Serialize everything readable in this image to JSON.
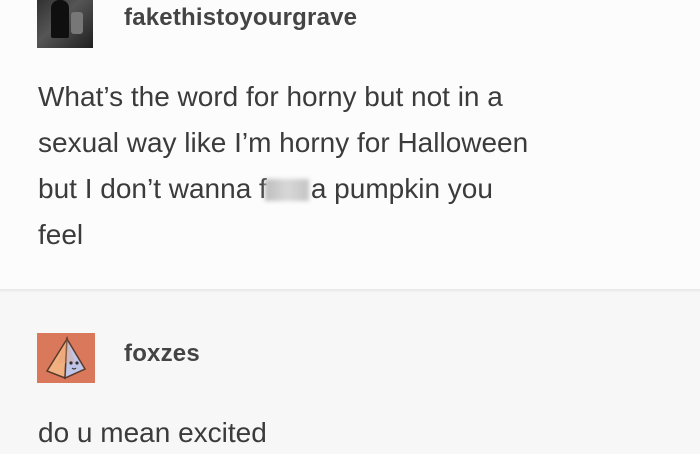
{
  "posts": [
    {
      "username": "fakethistoyourgrave",
      "avatar_icon": "user-photo-avatar",
      "text_lines": [
        "What’s the word for horny but not in a",
        "sexual way like I’m horny for Halloween",
        "but I don’t wanna f",
        "a pumpkin you",
        "feel"
      ]
    },
    {
      "username": "foxzes",
      "avatar_icon": "pyramid-avatar",
      "text": "do u mean excited"
    }
  ],
  "colors": {
    "avatar2_bg": "#d9785a",
    "text": "#3b3b3b"
  }
}
